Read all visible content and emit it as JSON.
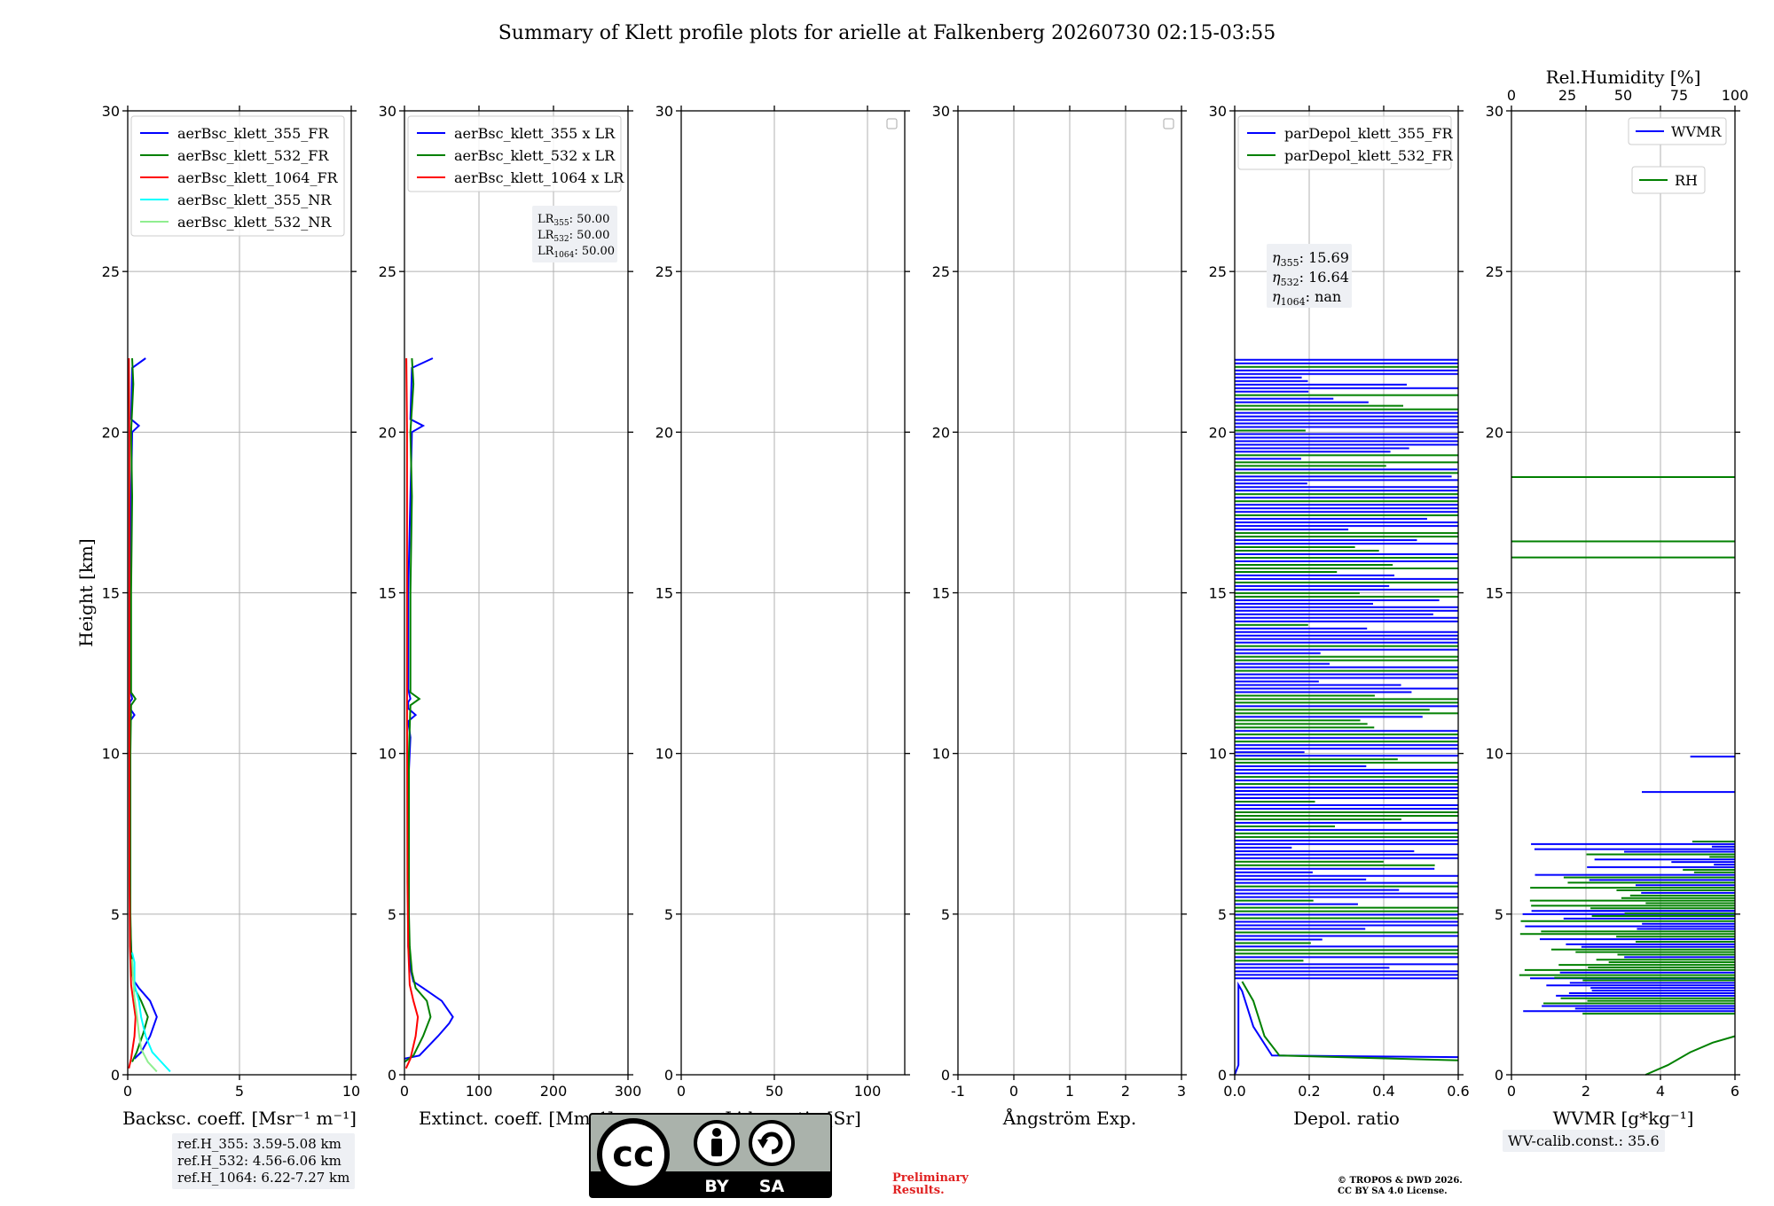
{
  "title": "Summary of Klett profile plots for arielle at Falkenberg 20260730 02:15-03:55",
  "chart_data": [
    {
      "type": "line",
      "panel": "backscatter",
      "xlabel": "Backsc. coeff. [Msr⁻¹ m⁻¹]",
      "ylabel": "Height [km]",
      "xlim": [
        0,
        10
      ],
      "ylim": [
        0,
        30
      ],
      "xticks": [
        0,
        5,
        10
      ],
      "yticks": [
        0,
        5,
        10,
        15,
        20,
        25,
        30
      ],
      "grid": true,
      "legend_position": "top-right",
      "series": [
        {
          "name": "aerBsc_klett_355_FR",
          "color": "#0000ff",
          "x": [
            0.3,
            0.6,
            1.0,
            1.3,
            1.0,
            0.5,
            0.3,
            0.2,
            0.15,
            0.1,
            0.1,
            0.1,
            0.12,
            0.1,
            0.3,
            0.1,
            0.1,
            0.2,
            0.1,
            0.1,
            0.15,
            0.2,
            0.5,
            0.15,
            0.2,
            0.8
          ],
          "y": [
            0.5,
            0.7,
            1.2,
            1.8,
            2.3,
            2.7,
            2.9,
            3.3,
            4.0,
            5.0,
            7.0,
            9.0,
            10.5,
            11.0,
            11.2,
            11.4,
            11.6,
            11.7,
            12.0,
            15.0,
            18.0,
            20.0,
            20.2,
            20.4,
            22.0,
            22.3
          ]
        },
        {
          "name": "aerBsc_klett_532_FR",
          "color": "#008000",
          "x": [
            0.2,
            0.4,
            0.7,
            0.9,
            0.6,
            0.3,
            0.2,
            0.15,
            0.12,
            0.12,
            0.12,
            0.15,
            0.35,
            0.15,
            0.15,
            0.2,
            0.15,
            0.25,
            0.2
          ],
          "y": [
            0.4,
            0.7,
            1.3,
            1.8,
            2.3,
            2.7,
            3.2,
            4.0,
            5.0,
            8.0,
            10.0,
            11.5,
            11.7,
            11.9,
            15.0,
            18.0,
            20.0,
            21.5,
            22.3
          ]
        },
        {
          "name": "aerBsc_klett_1064_FR",
          "color": "#ff0000",
          "x": [
            0.05,
            0.15,
            0.3,
            0.35,
            0.25,
            0.15,
            0.1,
            0.08,
            0.07,
            0.07,
            0.05
          ],
          "y": [
            0.2,
            0.5,
            1.2,
            1.8,
            2.3,
            2.8,
            4.0,
            6.0,
            11.0,
            20.0,
            22.3
          ]
        },
        {
          "name": "aerBsc_klett_355_NR",
          "color": "#00ffff",
          "x": [
            1.9,
            1.5,
            1.1,
            0.8,
            0.6,
            0.5,
            0.3,
            0.3,
            0.2
          ],
          "y": [
            0.1,
            0.4,
            0.7,
            1.2,
            1.8,
            2.3,
            2.8,
            3.5,
            3.8
          ]
        },
        {
          "name": "aerBsc_klett_532_NR",
          "color": "#90ee90",
          "x": [
            1.3,
            0.9,
            0.6,
            0.5,
            0.4,
            0.3,
            0.25,
            0.2
          ],
          "y": [
            0.1,
            0.4,
            0.8,
            1.3,
            1.9,
            2.4,
            2.9,
            3.6
          ]
        }
      ],
      "annotations": [
        "ref.H_355: 3.59-5.08 km",
        "ref.H_532: 4.56-6.06 km",
        "ref.H_1064: 6.22-7.27 km"
      ]
    },
    {
      "type": "line",
      "panel": "extinction",
      "xlabel": "Extinct. coeff. [Mm⁻¹]",
      "xlim": [
        0,
        300
      ],
      "ylim": [
        0,
        30
      ],
      "xticks": [
        0,
        100,
        200,
        300
      ],
      "yticks": [
        0,
        5,
        10,
        15,
        20,
        25,
        30
      ],
      "grid": true,
      "legend_position": "top-right",
      "series": [
        {
          "name": "aerBsc_klett_355 x LR",
          "color": "#0000ff",
          "x": [
            0,
            20,
            45,
            60,
            65,
            50,
            25,
            12,
            8,
            5,
            5,
            5,
            8,
            5,
            15,
            5,
            5,
            8,
            5,
            5,
            8,
            10,
            25,
            8,
            10,
            38
          ],
          "y": [
            0.5,
            0.6,
            1.2,
            1.6,
            1.8,
            2.3,
            2.7,
            2.9,
            3.3,
            4.0,
            7.0,
            9.0,
            10.5,
            11.0,
            11.2,
            11.4,
            11.6,
            11.7,
            12.0,
            15.0,
            18.0,
            20.0,
            20.2,
            20.4,
            22.0,
            22.3
          ]
        },
        {
          "name": "aerBsc_klett_532 x LR",
          "color": "#008000",
          "x": [
            0,
            12,
            25,
            35,
            30,
            15,
            10,
            7,
            6,
            6,
            6,
            8,
            20,
            8,
            8,
            10,
            8,
            12,
            10
          ],
          "y": [
            0.4,
            0.6,
            1.2,
            1.8,
            2.3,
            2.7,
            3.2,
            4.0,
            5.0,
            8.0,
            10.0,
            11.5,
            11.7,
            11.9,
            15.0,
            18.0,
            20.0,
            21.5,
            22.3
          ]
        },
        {
          "name": "aerBsc_klett_1064 x LR",
          "color": "#ff0000",
          "x": [
            2,
            8,
            15,
            18,
            12,
            7,
            5,
            4,
            3.5,
            3.5,
            2.5
          ],
          "y": [
            0.2,
            0.5,
            1.2,
            1.8,
            2.3,
            2.8,
            4.0,
            6.0,
            11.0,
            20.0,
            22.3
          ]
        }
      ],
      "annotations": [
        "LR355: 50.00",
        "LR532: 50.00",
        "LR1064: 50.00"
      ]
    },
    {
      "type": "line",
      "panel": "lidar-ratio",
      "xlabel": "Lidar ratio [Sr]",
      "xlim": [
        0,
        120
      ],
      "ylim": [
        0,
        30
      ],
      "xticks": [
        0,
        50,
        100
      ],
      "yticks": [
        0,
        5,
        10,
        15,
        20,
        25,
        30
      ],
      "grid": true,
      "series": []
    },
    {
      "type": "line",
      "panel": "angstrom",
      "xlabel": "Ångström Exp.",
      "xlim": [
        -1,
        3
      ],
      "ylim": [
        0,
        30
      ],
      "xticks": [
        -1,
        0,
        1,
        2,
        3
      ],
      "yticks": [
        0,
        5,
        10,
        15,
        20,
        25,
        30
      ],
      "grid": true,
      "series": []
    },
    {
      "type": "line",
      "panel": "depolarization",
      "xlabel": "Depol. ratio",
      "xlim": [
        0.0,
        0.6
      ],
      "ylim": [
        0,
        30
      ],
      "xticks": [
        0.0,
        0.2,
        0.4,
        0.6
      ],
      "xtick_labels": [
        "0.0",
        "0.2",
        "0.4",
        "0.6"
      ],
      "yticks": [
        0,
        5,
        10,
        15,
        20,
        25,
        30
      ],
      "grid": true,
      "legend_position": "top-right",
      "series": [
        {
          "name": "parDepol_klett_355_FR",
          "color": "#0000ff",
          "x": [
            0.0,
            0.01,
            0.01,
            0.02,
            0.05,
            0.1,
            0.6
          ],
          "y": [
            0.0,
            0.3,
            2.8,
            2.6,
            1.5,
            0.6,
            0.55
          ]
        },
        {
          "name": "parDepol_klett_532_FR",
          "color": "#008000",
          "x": [
            0.02,
            0.05,
            0.08,
            0.12,
            0.6
          ],
          "y": [
            2.9,
            2.3,
            1.2,
            0.6,
            0.45
          ]
        }
      ],
      "noisy_region_km": [
        3.0,
        22.3
      ],
      "annotations": [
        "η355: 15.69",
        "η532: 16.64",
        "η1064: nan"
      ]
    },
    {
      "type": "line",
      "panel": "water-vapor",
      "xlabel": "WVMR [g*kg⁻¹]",
      "xlim": [
        0,
        6
      ],
      "ylim": [
        0,
        30
      ],
      "xticks": [
        0,
        2,
        4,
        6
      ],
      "yticks": [
        0,
        5,
        10,
        15,
        20,
        25,
        30
      ],
      "secondary_xlabel": "Rel.Humidity [%]",
      "secondary_xlim": [
        0,
        100
      ],
      "secondary_xticks": [
        0,
        25,
        50,
        75,
        100
      ],
      "grid": true,
      "series": [
        {
          "name": "WVMR",
          "color": "#0000ff",
          "bars": [
            [
              3.5,
              8.8
            ],
            [
              4.8,
              9.9
            ],
            [
              1.3,
              5.1
            ],
            [
              0.5,
              3.0
            ],
            [
              0.3,
              5.0
            ]
          ]
        },
        {
          "name": "RH",
          "color": "#008000",
          "x": [
            60,
            70,
            80,
            90,
            100
          ],
          "y": [
            0.0,
            0.3,
            0.7,
            1.0,
            1.2
          ],
          "hlines": [
            16.1,
            16.6,
            18.6
          ]
        }
      ],
      "annotations": [
        "WV-calib.const.: 35.6"
      ]
    }
  ],
  "footer": {
    "cc_badge": {
      "left": "BY",
      "right": "SA",
      "cc": "cc"
    },
    "preliminary": [
      "Preliminary",
      "Results."
    ],
    "copyright": [
      "© TROPOS & DWD 2026.",
      "CC BY SA 4.0 License."
    ]
  },
  "colors": {
    "blue": "#0000ff",
    "green": "#008000",
    "red": "#ff0000",
    "cyan": "#00ffff",
    "lightgreen": "#90ee90",
    "grid": "#b0b0b0",
    "prelim": "#e02020"
  }
}
